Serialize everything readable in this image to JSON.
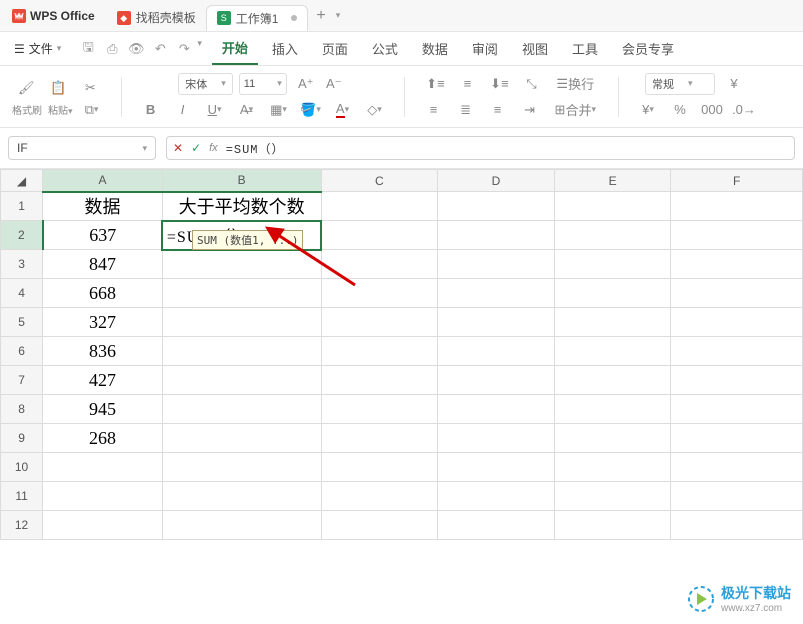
{
  "app": {
    "name": "WPS Office"
  },
  "tabs": [
    {
      "label": "找稻壳模板",
      "icon_bg": "#e84b3a",
      "icon_char": "D"
    },
    {
      "label": "工作簿1",
      "icon_bg": "#2a9a5c",
      "icon_char": "S",
      "active": true
    }
  ],
  "file_menu": "文件",
  "menu": [
    "开始",
    "插入",
    "页面",
    "公式",
    "数据",
    "审阅",
    "视图",
    "工具",
    "会员专享"
  ],
  "menu_active": 0,
  "ribbon": {
    "format_brush": "格式刷",
    "paste": "粘贴",
    "font_name": "宋体",
    "font_size": "11",
    "wrap_text": "换行",
    "merge": "合并",
    "num_format": "常规"
  },
  "name_box": "IF",
  "formula": "=SUM（）",
  "columns": [
    "A",
    "B",
    "C",
    "D",
    "E",
    "F"
  ],
  "rows": [
    1,
    2,
    3,
    4,
    5,
    6,
    7,
    8,
    9,
    10,
    11,
    12
  ],
  "cells": {
    "A1": "数据",
    "B1": "大于平均数个数",
    "A2": "637",
    "B2": "=SUM（）",
    "A3": "847",
    "A4": "668",
    "A5": "327",
    "A6": "836",
    "A7": "427",
    "A8": "945",
    "A9": "268"
  },
  "tooltip": "SUM (数值1, ...)",
  "watermark": {
    "brand": "极光下载站",
    "url": "www.xz7.com"
  }
}
